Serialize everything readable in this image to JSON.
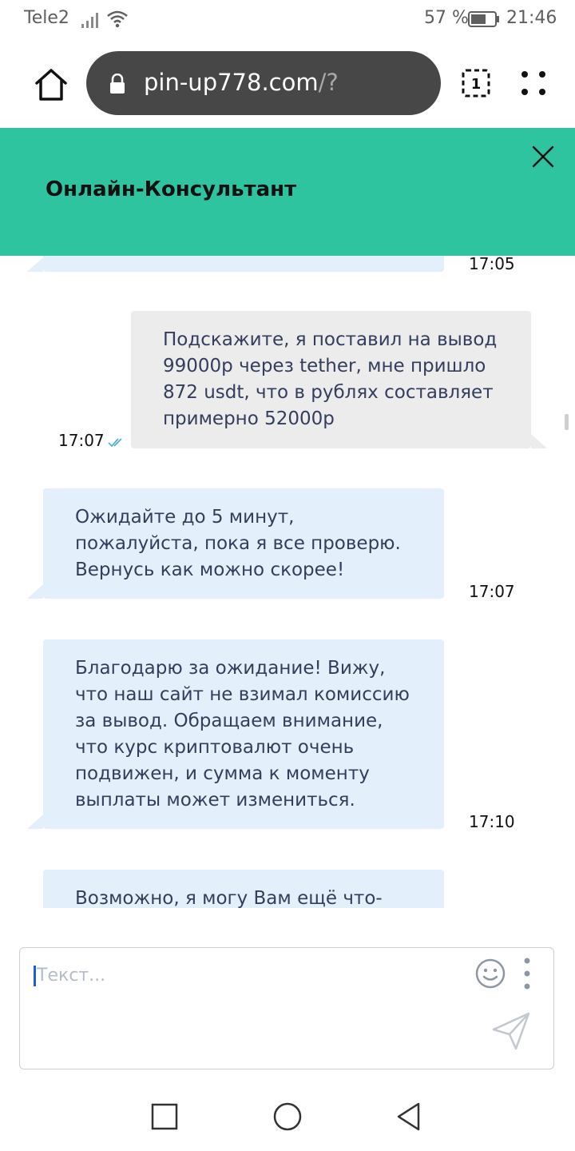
{
  "status_bar": {
    "carrier": "Tele2",
    "battery_percent": "57 %",
    "time": "21:46",
    "icons": [
      "signal-icon",
      "wifi-icon",
      "battery-icon"
    ]
  },
  "browser": {
    "url_domain": "pin-up778.com",
    "url_path": "/?",
    "tab_count": "1",
    "icons": [
      "home-icon",
      "lock-icon",
      "tabs-icon",
      "menu-icon"
    ]
  },
  "chat": {
    "title": "Онлайн-Консультант",
    "accent_color": "#2ec4a0",
    "messages": [
      {
        "direction": "incoming",
        "lines": [],
        "time": "17:05"
      },
      {
        "direction": "outgoing",
        "lines": [
          "Подскажите, я поставил на вывод",
          "99000р через tether, мне пришло",
          "872 usdt, что в рублях составляет",
          "примерно 52000р"
        ],
        "time": "17:07",
        "status": "read"
      },
      {
        "direction": "incoming",
        "lines": [
          "Ожидайте до 5 минут,",
          "пожалуйста, пока я все проверю.",
          "Вернусь как можно скорее!"
        ],
        "time": "17:07"
      },
      {
        "direction": "incoming",
        "lines": [
          "Благодарю за ожидание! Вижу,",
          "что наш сайт не взимал комиссию",
          "за вывод. Обращаем внимание,",
          "что курс криптовалют очень",
          "подвижен, и сумма к моменту",
          "выплаты может измениться."
        ],
        "time": "17:10"
      },
      {
        "direction": "incoming",
        "lines": [
          "Возможно, я могу Вам ещё что-"
        ],
        "time": ""
      }
    ]
  },
  "input": {
    "placeholder": "Текст...",
    "value": ""
  },
  "nav": {
    "icons": [
      "nav-recent-icon",
      "nav-home-icon",
      "nav-back-icon"
    ]
  }
}
